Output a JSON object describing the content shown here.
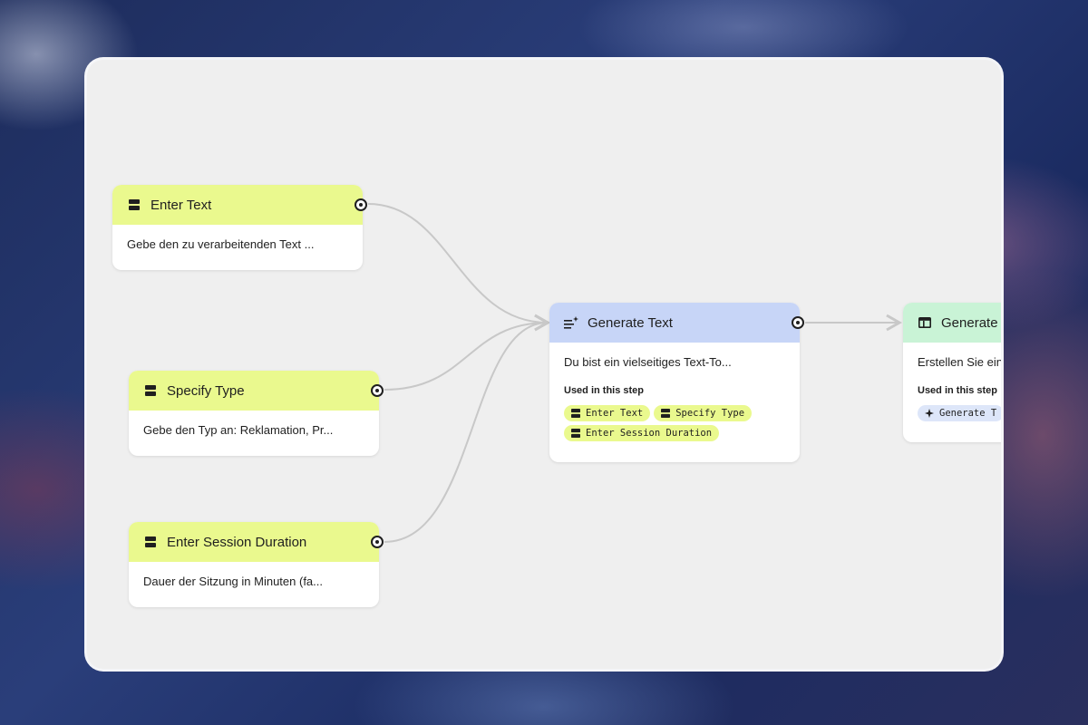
{
  "nodes": {
    "enter_text": {
      "title": "Enter Text",
      "description": "Gebe den zu verarbeitenden Text ..."
    },
    "specify_type": {
      "title": "Specify Type",
      "description": "Gebe den Typ an: Reklamation, Pr..."
    },
    "enter_session_duration": {
      "title": "Enter Session Duration",
      "description": "Dauer der Sitzung in Minuten (fa..."
    },
    "generate_text": {
      "title": "Generate Text",
      "description": "Du bist ein vielseitiges Text-To...",
      "used_label": "Used in this step",
      "chips": [
        "Enter Text",
        "Specify Type",
        "Enter Session Duration"
      ]
    },
    "generate_partial": {
      "title": "Generate",
      "description": "Erstellen Sie ein",
      "used_label": "Used in this step",
      "chip": "Generate T"
    }
  },
  "colors": {
    "input_header": "#eaf98e",
    "generate_header": "#c7d5f7",
    "output_header": "#c9f3d6",
    "edge": "#c8c8c8"
  },
  "icons": {
    "input": "input-block-icon",
    "generate": "text-sparkle-icon",
    "output": "layout-window-icon",
    "chip_generate": "sparkle-icon"
  }
}
